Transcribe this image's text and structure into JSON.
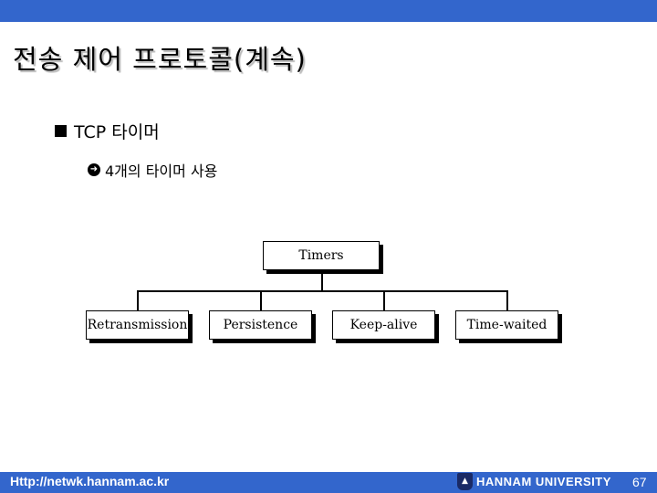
{
  "slide": {
    "title": "전송 제어 프로토콜(계속)",
    "bullets": [
      {
        "level": 1,
        "icon": "square-bullet-icon",
        "text": "TCP 타이머"
      },
      {
        "level": 2,
        "icon": "circled-arrow-icon",
        "text": "4개의 타이머 사용"
      }
    ]
  },
  "diagram": {
    "root": "Timers",
    "children": [
      "Retransmission",
      "Persistence",
      "Keep-alive",
      "Time-waited"
    ]
  },
  "footer": {
    "url": "Http://netwk.hannam.ac.kr",
    "logo_icon": "university-shield-icon",
    "university": "HANNAM  UNIVERSITY",
    "page_number": "67"
  },
  "colors": {
    "bar": "#3366cc",
    "text": "#000000",
    "footer_text": "#ffffff"
  }
}
